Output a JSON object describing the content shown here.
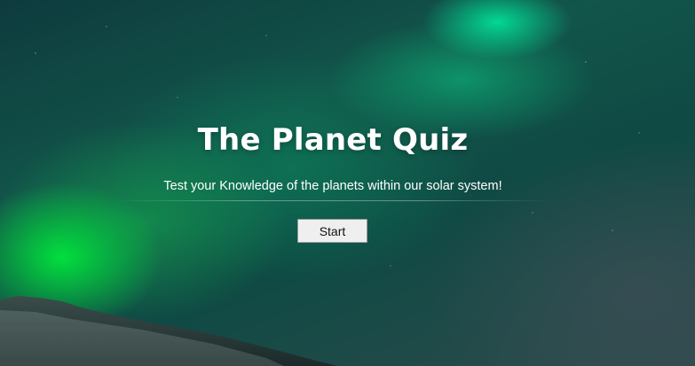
{
  "hero": {
    "title": "The Planet Quiz",
    "subtitle": "Test your Knowledge of the planets within our solar system!",
    "start_button_label": "Start"
  },
  "colors": {
    "title_text": "#ffffff",
    "button_background": "#efefef",
    "button_border": "#9a9a9a",
    "aurora_green": "#00e63c",
    "sky": "#123f3c"
  }
}
